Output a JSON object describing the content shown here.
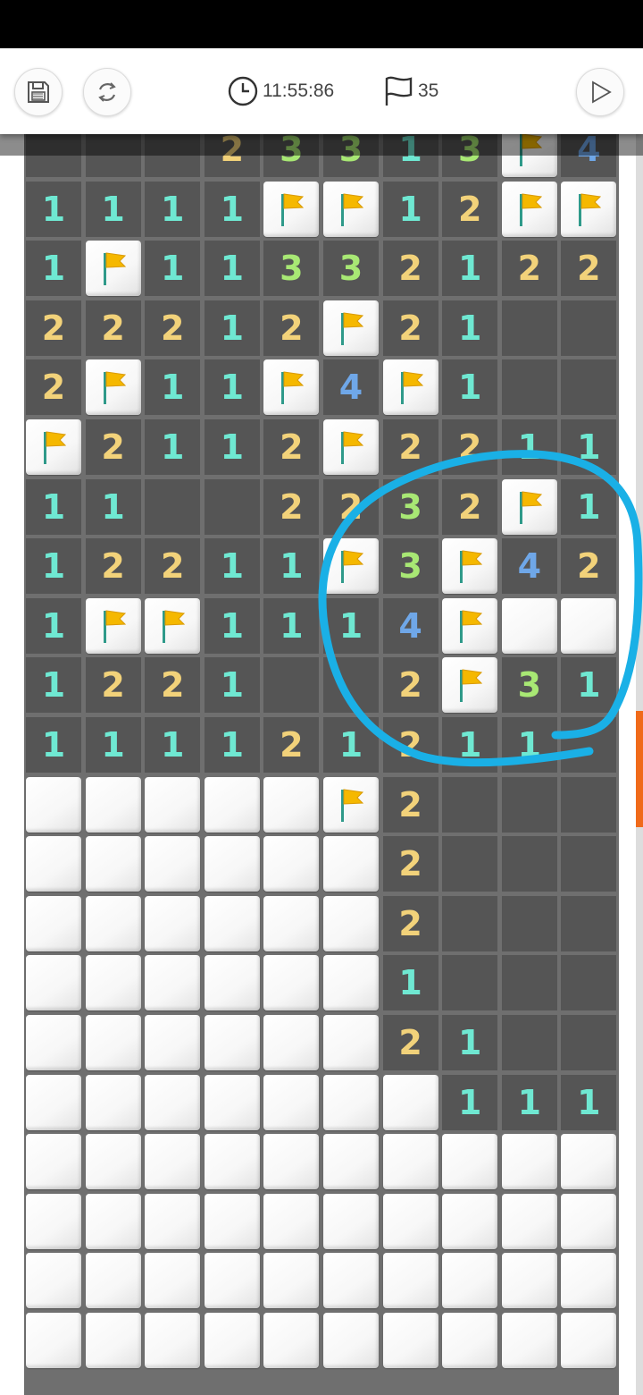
{
  "toolbar": {
    "timer": "11:55:86",
    "flags_remaining": "35",
    "save_icon": "save-icon",
    "restart_icon": "restart-icon",
    "play_icon": "play-icon"
  },
  "colors": {
    "1": "#6fe8d2",
    "2": "#f2d27a",
    "3": "#a8e874",
    "4": "#6fa7e8",
    "annotation": "#1ab0e6",
    "flag": "#f5b800",
    "scroll_thumb": "#f06a1a"
  },
  "board": {
    "rows": [
      "OOO2331 3F4",
      "1111FF12FF",
      "1F113321 22",
      "222 12F21OO",
      "2F11F4F1OO",
      "F2112F2211",
      "11OO223 2F1",
      "12211F3F42",
      "1FF111 4F##",
      "1221OO2F31",
      "1111212 11O",
      "#####F2OOO",
      "######2OOO",
      "######2OOO",
      "######1OOO",
      "######21OO",
      "#######111",
      "##########",
      "##########",
      "##########",
      "##########"
    ],
    "grid": [
      [
        "O",
        "O",
        "O",
        "2",
        "3",
        "3",
        "1",
        "3",
        "F",
        "4"
      ],
      [
        "1",
        "1",
        "1",
        "1",
        "F",
        "F",
        "1",
        "2",
        "F",
        "F"
      ],
      [
        "1",
        "F",
        "1",
        "1",
        "3",
        "3",
        "2",
        "1",
        "2",
        "2"
      ],
      [
        "2",
        "2",
        "2",
        "1",
        "2",
        "F",
        "2",
        "1",
        "O",
        "O"
      ],
      [
        "2",
        "F",
        "1",
        "1",
        "F",
        "4",
        "F",
        "1",
        "O",
        "O"
      ],
      [
        "F",
        "2",
        "1",
        "1",
        "2",
        "F",
        "2",
        "2",
        "1",
        "1"
      ],
      [
        "1",
        "1",
        "O",
        "O",
        "2",
        "2",
        "3",
        "2",
        "F",
        "1"
      ],
      [
        "1",
        "2",
        "2",
        "1",
        "1",
        "F",
        "3",
        "F",
        "4",
        "2"
      ],
      [
        "1",
        "F",
        "F",
        "1",
        "1",
        "1",
        "4",
        "F",
        "#",
        "#"
      ],
      [
        "1",
        "2",
        "2",
        "1",
        "O",
        "O",
        "2",
        "F",
        "3",
        "1"
      ],
      [
        "1",
        "1",
        "1",
        "1",
        "2",
        "1",
        "2",
        "1",
        "1",
        "O"
      ],
      [
        "#",
        "#",
        "#",
        "#",
        "#",
        "F",
        "2",
        "O",
        "O",
        "O"
      ],
      [
        "#",
        "#",
        "#",
        "#",
        "#",
        "#",
        "2",
        "O",
        "O",
        "O"
      ],
      [
        "#",
        "#",
        "#",
        "#",
        "#",
        "#",
        "2",
        "O",
        "O",
        "O"
      ],
      [
        "#",
        "#",
        "#",
        "#",
        "#",
        "#",
        "1",
        "O",
        "O",
        "O"
      ],
      [
        "#",
        "#",
        "#",
        "#",
        "#",
        "#",
        "2",
        "1",
        "O",
        "O"
      ],
      [
        "#",
        "#",
        "#",
        "#",
        "#",
        "#",
        "#",
        "1",
        "1",
        "1"
      ],
      [
        "#",
        "#",
        "#",
        "#",
        "#",
        "#",
        "#",
        "#",
        "#",
        "#"
      ],
      [
        "#",
        "#",
        "#",
        "#",
        "#",
        "#",
        "#",
        "#",
        "#",
        "#"
      ],
      [
        "#",
        "#",
        "#",
        "#",
        "#",
        "#",
        "#",
        "#",
        "#",
        "#"
      ],
      [
        "#",
        "#",
        "#",
        "#",
        "#",
        "#",
        "#",
        "#",
        "#",
        "#"
      ]
    ],
    "legend": {
      "O": "revealed-empty",
      "#": "unrevealed",
      "F": "flagged"
    }
  }
}
